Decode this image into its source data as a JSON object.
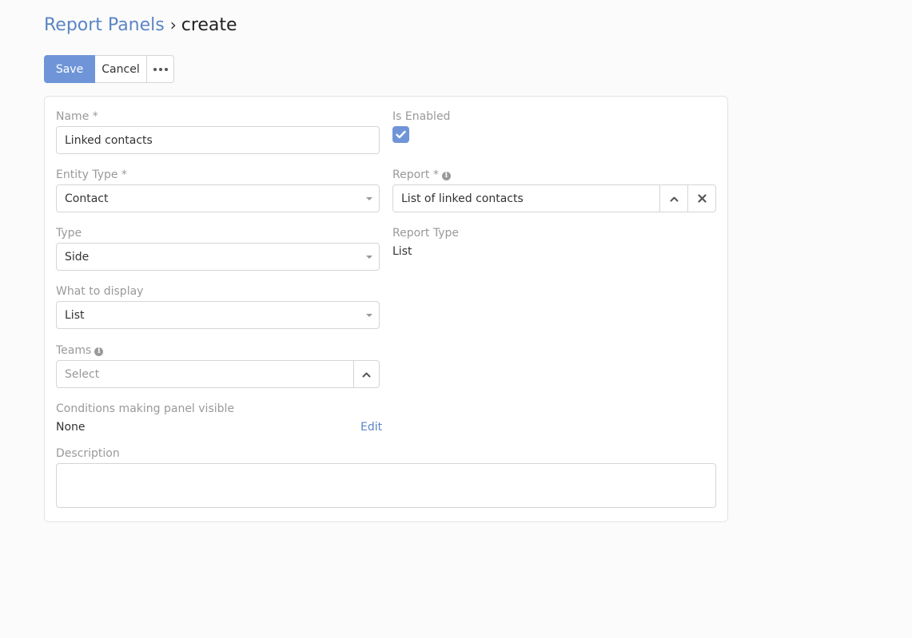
{
  "breadcrumb": {
    "parent": "Report Panels",
    "separator": "›",
    "current": "create"
  },
  "toolbar": {
    "save_label": "Save",
    "cancel_label": "Cancel",
    "more_icon": "ellipsis-icon"
  },
  "form": {
    "name": {
      "label": "Name *",
      "value": "Linked contacts"
    },
    "is_enabled": {
      "label": "Is Enabled",
      "checked": true
    },
    "entity_type": {
      "label": "Entity Type *",
      "value": "Contact"
    },
    "report": {
      "label": "Report *",
      "value": "List of linked contacts"
    },
    "type": {
      "label": "Type",
      "value": "Side"
    },
    "report_type": {
      "label": "Report Type",
      "value": "List"
    },
    "what_to_display": {
      "label": "What to display",
      "value": "List"
    },
    "teams": {
      "label": "Teams",
      "placeholder": "Select"
    },
    "conditions": {
      "label": "Conditions making panel visible",
      "value": "None",
      "edit_label": "Edit"
    },
    "description": {
      "label": "Description",
      "value": ""
    }
  },
  "colors": {
    "accent": "#6f95d8",
    "link": "#5b85c4",
    "label": "#999999",
    "border": "#d5d5d5",
    "background": "#fbfbfb"
  }
}
